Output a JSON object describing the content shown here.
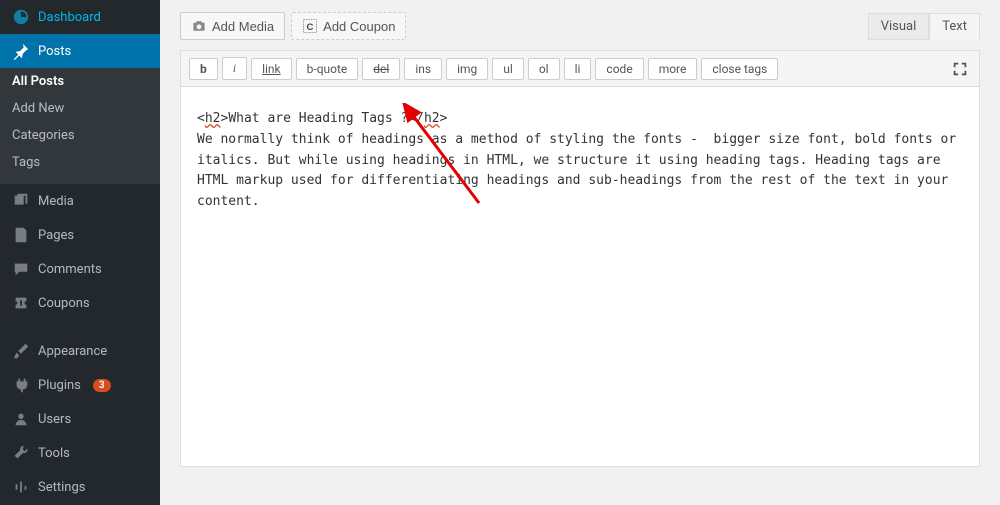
{
  "sidebar": {
    "items": [
      {
        "label": "Dashboard"
      },
      {
        "label": "Posts"
      },
      {
        "label": "Media"
      },
      {
        "label": "Pages"
      },
      {
        "label": "Comments"
      },
      {
        "label": "Coupons"
      },
      {
        "label": "Appearance"
      },
      {
        "label": "Plugins",
        "badge": "3"
      },
      {
        "label": "Users"
      },
      {
        "label": "Tools"
      },
      {
        "label": "Settings"
      }
    ],
    "submenu": [
      {
        "label": "All Posts"
      },
      {
        "label": "Add New"
      },
      {
        "label": "Categories"
      },
      {
        "label": "Tags"
      }
    ]
  },
  "media_buttons": {
    "add_media": "Add Media",
    "add_coupon": "Add Coupon"
  },
  "editor_tabs": {
    "visual": "Visual",
    "text": "Text"
  },
  "toolbar": {
    "b": "b",
    "i": "i",
    "link": "link",
    "bquote": "b-quote",
    "del": "del",
    "ins": "ins",
    "img": "img",
    "ul": "ul",
    "ol": "ol",
    "li": "li",
    "code": "code",
    "more": "more",
    "close": "close tags"
  },
  "content": {
    "line1_open": "<h2>",
    "line1_text": "What are Heading Tags ?",
    "line1_close": "</h2>",
    "line2": "We normally think of headings as a method of styling the fonts -  bigger size font, bold fonts or italics. But while using headings in HTML, we structure it using heading tags. Heading tags are HTML markup used for differentiating headings and sub-headings from the rest of the text in your content."
  }
}
